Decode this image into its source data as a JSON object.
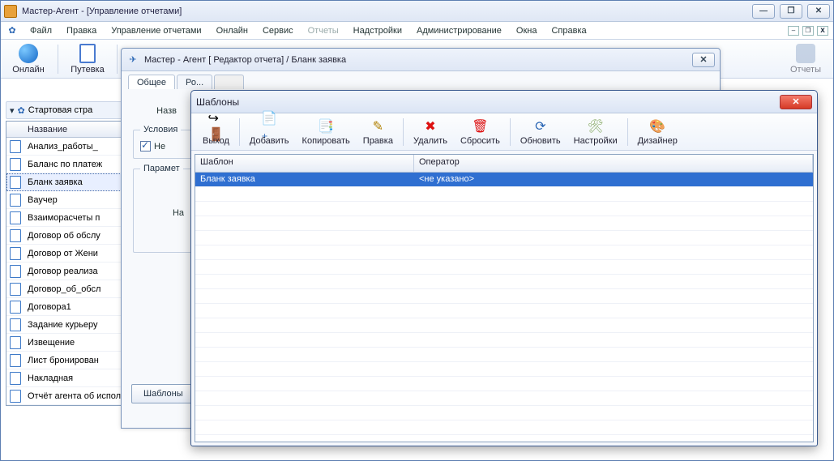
{
  "window": {
    "title": "Мастер-Агент - [Управление отчетами]"
  },
  "window_buttons": {
    "min": "—",
    "max": "❐",
    "close": "✕"
  },
  "menu": {
    "items": [
      "Файл",
      "Правка",
      "Управление отчетами",
      "Онлайн",
      "Сервис",
      "Отчеты",
      "Надстройки",
      "Администрирование",
      "Окна",
      "Справка"
    ],
    "dim_index": 5
  },
  "mdi": {
    "min": "–",
    "restore": "❐",
    "close": "x"
  },
  "main_toolbar": {
    "online": "Онлайн",
    "voucher": "Путевка",
    "reports_far": "Отчеты"
  },
  "left": {
    "start_page": "Стартовая стра",
    "header": "Название",
    "rows": [
      {
        "t": "Анализ_работы_",
        "g": false
      },
      {
        "t": "Баланс по платеж",
        "g": false
      },
      {
        "t": "Бланк заявка",
        "g": false,
        "sel": true
      },
      {
        "t": "Ваучер",
        "g": true
      },
      {
        "t": "Взаиморасчеты п",
        "g": false
      },
      {
        "t": "Договор об обслу",
        "g": false
      },
      {
        "t": "Договор от Жени",
        "g": false
      },
      {
        "t": "Договор реализа",
        "g": false
      },
      {
        "t": "Договор_об_обсл",
        "g": false
      },
      {
        "t": "Договора1",
        "g": false
      },
      {
        "t": "Задание курьеру",
        "g": false
      },
      {
        "t": "Извещение",
        "g": false
      },
      {
        "t": "Лист бронирован",
        "g": false
      },
      {
        "t": "Накладная",
        "g": false
      },
      {
        "t": "Отчёт агента об исполнении по",
        "g": false
      }
    ]
  },
  "editor": {
    "title": "Мастер - Агент [ Редактор отчета] / Бланк заявка",
    "close": "✕",
    "tabs": [
      "Общее",
      "Ро..."
    ],
    "name_label": "Назв",
    "conditions_label": "Условия",
    "checkbox_label": "Не",
    "params_label": "Парамет",
    "na_label": "На",
    "templates_btn": "Шаблоны"
  },
  "modal": {
    "title": "Шаблоны",
    "close": "✕",
    "buttons": {
      "exit": "Выход",
      "add": "Добавить",
      "copy": "Копировать",
      "edit": "Правка",
      "delete": "Удалить",
      "reset": "Сбросить",
      "refresh": "Обновить",
      "settings": "Настройки",
      "designer": "Дизайнер"
    },
    "columns": {
      "c1": "Шаблон",
      "c2": "Оператор"
    },
    "row": {
      "c1": "Бланк заявка",
      "c2": "<не указано>"
    }
  }
}
